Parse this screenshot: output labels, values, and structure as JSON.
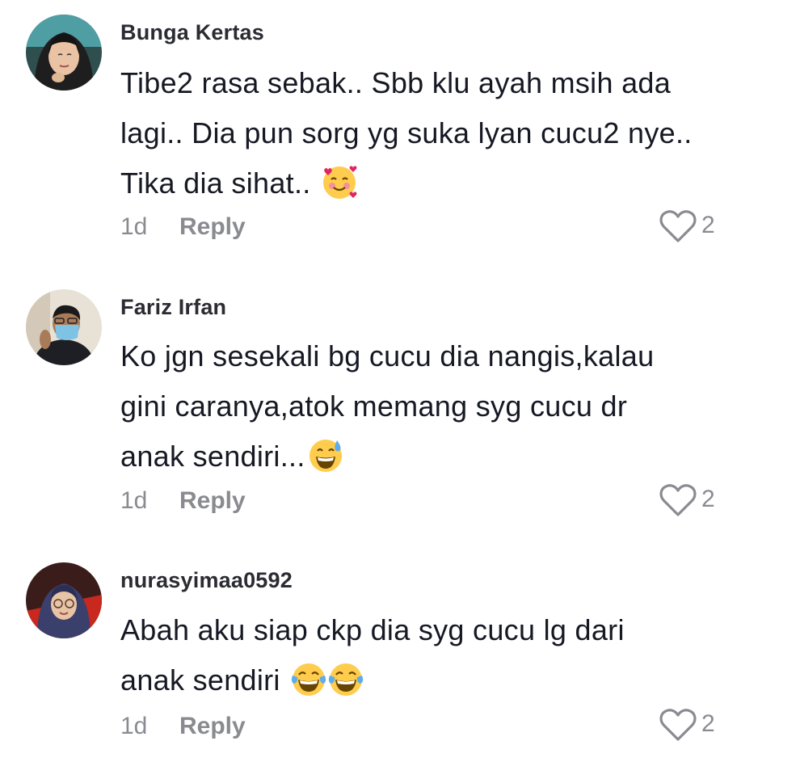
{
  "comments": [
    {
      "username": "Bunga Kertas",
      "lines": [
        "Tibe2 rasa sebak.. Sbb klu ayah msih ada",
        "lagi.. Dia pun sorg yg suka lyan cucu2 nye..",
        "Tika dia sihat.."
      ],
      "emojis": [
        "smiling-face-with-hearts"
      ],
      "age": "1d",
      "reply_label": "Reply",
      "likes": "2"
    },
    {
      "username": "Fariz Irfan",
      "lines": [
        "Ko jgn sesekali bg cucu dia nangis,kalau",
        "gini caranya,atok memang syg cucu dr",
        "anak sendiri..."
      ],
      "emojis": [
        "grinning-face-with-sweat"
      ],
      "age": "1d",
      "reply_label": "Reply",
      "likes": "2"
    },
    {
      "username": "nurasyimaa0592",
      "lines": [
        "Abah aku siap ckp dia syg cucu lg dari",
        "anak sendiri"
      ],
      "emojis": [
        "face-with-tears-of-joy",
        "face-with-tears-of-joy"
      ],
      "age": "1d",
      "reply_label": "Reply",
      "likes": "2"
    }
  ],
  "colors": {
    "text": "#161823",
    "secondary": "#8a8b91",
    "username": "#2b2b33"
  }
}
